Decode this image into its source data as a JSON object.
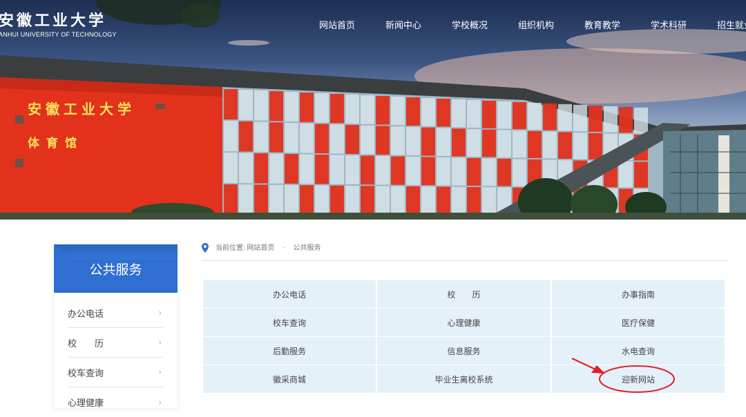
{
  "header": {
    "logo_cn": "安徽工业大学",
    "logo_en": "ANHUI UNIVERSITY OF TECHNOLOGY",
    "nav": [
      "网站首页",
      "新闻中心",
      "学校概况",
      "组织机构",
      "教育教学",
      "学术科研",
      "招生就业"
    ]
  },
  "banner": {
    "building_sign_line1": "安徽工业大学",
    "building_sign_line2": "体育馆"
  },
  "sidebar": {
    "title": "公共服务",
    "items": [
      {
        "label": "办公电话"
      },
      {
        "label": "校　　历"
      },
      {
        "label": "校车查询"
      },
      {
        "label": "心理健康"
      }
    ]
  },
  "breadcrumb": {
    "prefix": "当前位置:",
    "home": "网站首页",
    "separator": "·",
    "current": "公共服务"
  },
  "services": [
    "办公电话",
    "校　　历",
    "办事指南",
    "校车查询",
    "心理健康",
    "医疗保健",
    "后勤服务",
    "信息服务",
    "水电查询",
    "徽采商城",
    "毕业生离校系统",
    "迎新网站"
  ],
  "colors": {
    "accent_blue": "#2f6fd1",
    "cell_bg": "#e5f1f9",
    "annotation_red": "#e0202a"
  }
}
